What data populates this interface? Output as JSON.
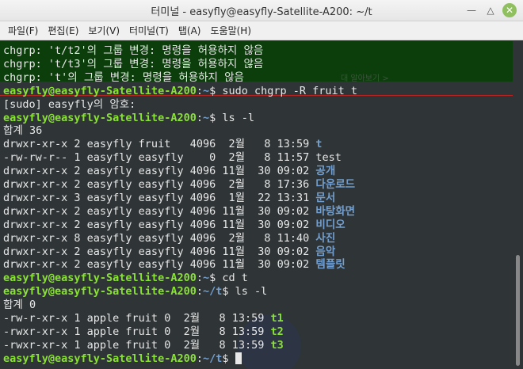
{
  "window": {
    "title": "터미널 - easyfly@easyfly-Satellite-A200: ~/t"
  },
  "menu": [
    "파일(F)",
    "편집(E)",
    "보기(V)",
    "터미널(T)",
    "탭(A)",
    "도움말(H)"
  ],
  "ghost_text": "대 알아보기 >",
  "lines": [
    {
      "parts": [
        {
          "t": "chgrp: 't/t2'의 그룹 변경: 명령을 허용하지 않음",
          "c": ""
        }
      ]
    },
    {
      "parts": [
        {
          "t": "chgrp: 't/t3'의 그룹 변경: 명령을 허용하지 않음",
          "c": ""
        }
      ]
    },
    {
      "parts": [
        {
          "t": "chgrp: 't'의 그룹 변경: 명령을 허용하지 않음",
          "c": ""
        }
      ]
    },
    {
      "parts": [
        {
          "t": "easyfly@easyfly-Satellite-A200",
          "c": "g"
        },
        {
          "t": ":",
          "c": ""
        },
        {
          "t": "~",
          "c": "b"
        },
        {
          "t": "$ sudo chgrp -R fruit t",
          "c": ""
        }
      ]
    },
    {
      "parts": [
        {
          "t": "[sudo] easyfly의 암호: ",
          "c": ""
        }
      ]
    },
    {
      "parts": [
        {
          "t": "easyfly@easyfly-Satellite-A200",
          "c": "g"
        },
        {
          "t": ":",
          "c": ""
        },
        {
          "t": "~",
          "c": "b"
        },
        {
          "t": "$ ls -l",
          "c": ""
        }
      ]
    },
    {
      "parts": [
        {
          "t": "합계 36",
          "c": ""
        }
      ]
    },
    {
      "parts": [
        {
          "t": "drwxr-xr-x 2 easyfly fruit   4096  2월   8 13:59 ",
          "c": ""
        },
        {
          "t": "t",
          "c": "b"
        }
      ]
    },
    {
      "parts": [
        {
          "t": "-rw-rw-r-- 1 easyfly easyfly    0  2월   8 11:57 test",
          "c": ""
        }
      ]
    },
    {
      "parts": [
        {
          "t": "drwxr-xr-x 2 easyfly easyfly 4096 11월  30 09:02 ",
          "c": ""
        },
        {
          "t": "공개",
          "c": "b"
        }
      ]
    },
    {
      "parts": [
        {
          "t": "drwxr-xr-x 2 easyfly easyfly 4096  2월   8 17:36 ",
          "c": ""
        },
        {
          "t": "다운로드",
          "c": "b"
        }
      ]
    },
    {
      "parts": [
        {
          "t": "drwxr-xr-x 3 easyfly easyfly 4096  1월  22 13:31 ",
          "c": ""
        },
        {
          "t": "문서",
          "c": "b"
        }
      ]
    },
    {
      "parts": [
        {
          "t": "drwxr-xr-x 2 easyfly easyfly 4096 11월  30 09:02 ",
          "c": ""
        },
        {
          "t": "바탕화면",
          "c": "b"
        }
      ]
    },
    {
      "parts": [
        {
          "t": "drwxr-xr-x 2 easyfly easyfly 4096 11월  30 09:02 ",
          "c": ""
        },
        {
          "t": "비디오",
          "c": "b"
        }
      ]
    },
    {
      "parts": [
        {
          "t": "drwxr-xr-x 8 easyfly easyfly 4096  2월   8 11:40 ",
          "c": ""
        },
        {
          "t": "사진",
          "c": "b"
        }
      ]
    },
    {
      "parts": [
        {
          "t": "drwxr-xr-x 2 easyfly easyfly 4096 11월  30 09:02 ",
          "c": ""
        },
        {
          "t": "음악",
          "c": "b"
        }
      ]
    },
    {
      "parts": [
        {
          "t": "drwxr-xr-x 2 easyfly easyfly 4096 11월  30 09:02 ",
          "c": ""
        },
        {
          "t": "템플릿",
          "c": "b"
        }
      ]
    },
    {
      "parts": [
        {
          "t": "easyfly@easyfly-Satellite-A200",
          "c": "g"
        },
        {
          "t": ":",
          "c": ""
        },
        {
          "t": "~",
          "c": "b"
        },
        {
          "t": "$ cd t",
          "c": ""
        }
      ]
    },
    {
      "parts": [
        {
          "t": "easyfly@easyfly-Satellite-A200",
          "c": "g"
        },
        {
          "t": ":",
          "c": ""
        },
        {
          "t": "~/t",
          "c": "b"
        },
        {
          "t": "$ ls -l",
          "c": ""
        }
      ]
    },
    {
      "parts": [
        {
          "t": "합계 0",
          "c": ""
        }
      ]
    },
    {
      "parts": [
        {
          "t": "-rw-r-xr-x 1 apple fruit 0  2월   8 13:59 ",
          "c": ""
        },
        {
          "t": "t1",
          "c": "x"
        }
      ]
    },
    {
      "parts": [
        {
          "t": "-rwxr-xr-x 1 apple fruit 0  2월   8 13:59 ",
          "c": ""
        },
        {
          "t": "t2",
          "c": "x"
        }
      ]
    },
    {
      "parts": [
        {
          "t": "-rwxr-xr-x 1 apple fruit 0  2월   8 13:59 ",
          "c": ""
        },
        {
          "t": "t3",
          "c": "x"
        }
      ]
    },
    {
      "parts": [
        {
          "t": "easyfly@easyfly-Satellite-A200",
          "c": "g"
        },
        {
          "t": ":",
          "c": ""
        },
        {
          "t": "~/t",
          "c": "b"
        },
        {
          "t": "$ ",
          "c": ""
        }
      ],
      "cursor": true
    }
  ],
  "colors": {
    "prompt_user": "#8ae234",
    "directory": "#729fcf",
    "executable": "#8ae234",
    "background": "#2f3436"
  },
  "icons": {
    "minimize": "minimize-icon",
    "maximize": "maximize-icon",
    "close": "close-icon"
  }
}
